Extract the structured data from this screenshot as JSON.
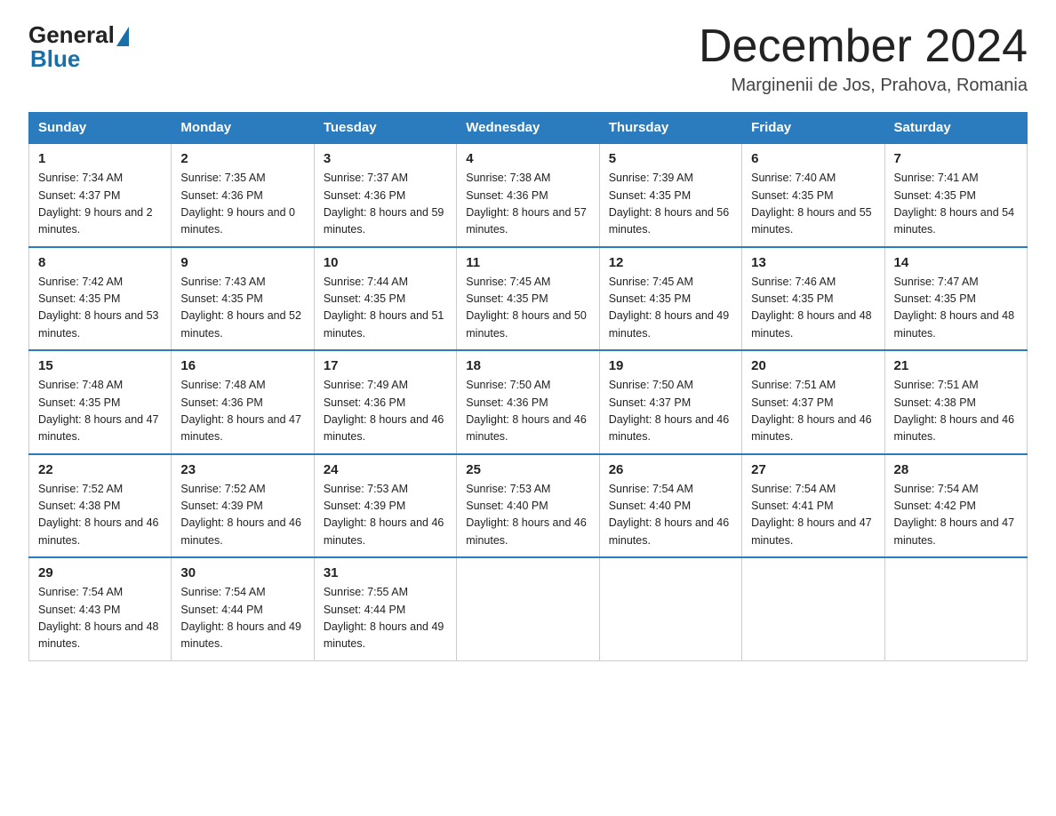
{
  "header": {
    "logo_general": "General",
    "logo_blue": "Blue",
    "month_title": "December 2024",
    "location": "Marginenii de Jos, Prahova, Romania"
  },
  "days_of_week": [
    "Sunday",
    "Monday",
    "Tuesday",
    "Wednesday",
    "Thursday",
    "Friday",
    "Saturday"
  ],
  "weeks": [
    [
      {
        "day": "1",
        "sunrise": "7:34 AM",
        "sunset": "4:37 PM",
        "daylight": "9 hours and 2 minutes."
      },
      {
        "day": "2",
        "sunrise": "7:35 AM",
        "sunset": "4:36 PM",
        "daylight": "9 hours and 0 minutes."
      },
      {
        "day": "3",
        "sunrise": "7:37 AM",
        "sunset": "4:36 PM",
        "daylight": "8 hours and 59 minutes."
      },
      {
        "day": "4",
        "sunrise": "7:38 AM",
        "sunset": "4:36 PM",
        "daylight": "8 hours and 57 minutes."
      },
      {
        "day": "5",
        "sunrise": "7:39 AM",
        "sunset": "4:35 PM",
        "daylight": "8 hours and 56 minutes."
      },
      {
        "day": "6",
        "sunrise": "7:40 AM",
        "sunset": "4:35 PM",
        "daylight": "8 hours and 55 minutes."
      },
      {
        "day": "7",
        "sunrise": "7:41 AM",
        "sunset": "4:35 PM",
        "daylight": "8 hours and 54 minutes."
      }
    ],
    [
      {
        "day": "8",
        "sunrise": "7:42 AM",
        "sunset": "4:35 PM",
        "daylight": "8 hours and 53 minutes."
      },
      {
        "day": "9",
        "sunrise": "7:43 AM",
        "sunset": "4:35 PM",
        "daylight": "8 hours and 52 minutes."
      },
      {
        "day": "10",
        "sunrise": "7:44 AM",
        "sunset": "4:35 PM",
        "daylight": "8 hours and 51 minutes."
      },
      {
        "day": "11",
        "sunrise": "7:45 AM",
        "sunset": "4:35 PM",
        "daylight": "8 hours and 50 minutes."
      },
      {
        "day": "12",
        "sunrise": "7:45 AM",
        "sunset": "4:35 PM",
        "daylight": "8 hours and 49 minutes."
      },
      {
        "day": "13",
        "sunrise": "7:46 AM",
        "sunset": "4:35 PM",
        "daylight": "8 hours and 48 minutes."
      },
      {
        "day": "14",
        "sunrise": "7:47 AM",
        "sunset": "4:35 PM",
        "daylight": "8 hours and 48 minutes."
      }
    ],
    [
      {
        "day": "15",
        "sunrise": "7:48 AM",
        "sunset": "4:35 PM",
        "daylight": "8 hours and 47 minutes."
      },
      {
        "day": "16",
        "sunrise": "7:48 AM",
        "sunset": "4:36 PM",
        "daylight": "8 hours and 47 minutes."
      },
      {
        "day": "17",
        "sunrise": "7:49 AM",
        "sunset": "4:36 PM",
        "daylight": "8 hours and 46 minutes."
      },
      {
        "day": "18",
        "sunrise": "7:50 AM",
        "sunset": "4:36 PM",
        "daylight": "8 hours and 46 minutes."
      },
      {
        "day": "19",
        "sunrise": "7:50 AM",
        "sunset": "4:37 PM",
        "daylight": "8 hours and 46 minutes."
      },
      {
        "day": "20",
        "sunrise": "7:51 AM",
        "sunset": "4:37 PM",
        "daylight": "8 hours and 46 minutes."
      },
      {
        "day": "21",
        "sunrise": "7:51 AM",
        "sunset": "4:38 PM",
        "daylight": "8 hours and 46 minutes."
      }
    ],
    [
      {
        "day": "22",
        "sunrise": "7:52 AM",
        "sunset": "4:38 PM",
        "daylight": "8 hours and 46 minutes."
      },
      {
        "day": "23",
        "sunrise": "7:52 AM",
        "sunset": "4:39 PM",
        "daylight": "8 hours and 46 minutes."
      },
      {
        "day": "24",
        "sunrise": "7:53 AM",
        "sunset": "4:39 PM",
        "daylight": "8 hours and 46 minutes."
      },
      {
        "day": "25",
        "sunrise": "7:53 AM",
        "sunset": "4:40 PM",
        "daylight": "8 hours and 46 minutes."
      },
      {
        "day": "26",
        "sunrise": "7:54 AM",
        "sunset": "4:40 PM",
        "daylight": "8 hours and 46 minutes."
      },
      {
        "day": "27",
        "sunrise": "7:54 AM",
        "sunset": "4:41 PM",
        "daylight": "8 hours and 47 minutes."
      },
      {
        "day": "28",
        "sunrise": "7:54 AM",
        "sunset": "4:42 PM",
        "daylight": "8 hours and 47 minutes."
      }
    ],
    [
      {
        "day": "29",
        "sunrise": "7:54 AM",
        "sunset": "4:43 PM",
        "daylight": "8 hours and 48 minutes."
      },
      {
        "day": "30",
        "sunrise": "7:54 AM",
        "sunset": "4:44 PM",
        "daylight": "8 hours and 49 minutes."
      },
      {
        "day": "31",
        "sunrise": "7:55 AM",
        "sunset": "4:44 PM",
        "daylight": "8 hours and 49 minutes."
      },
      null,
      null,
      null,
      null
    ]
  ]
}
